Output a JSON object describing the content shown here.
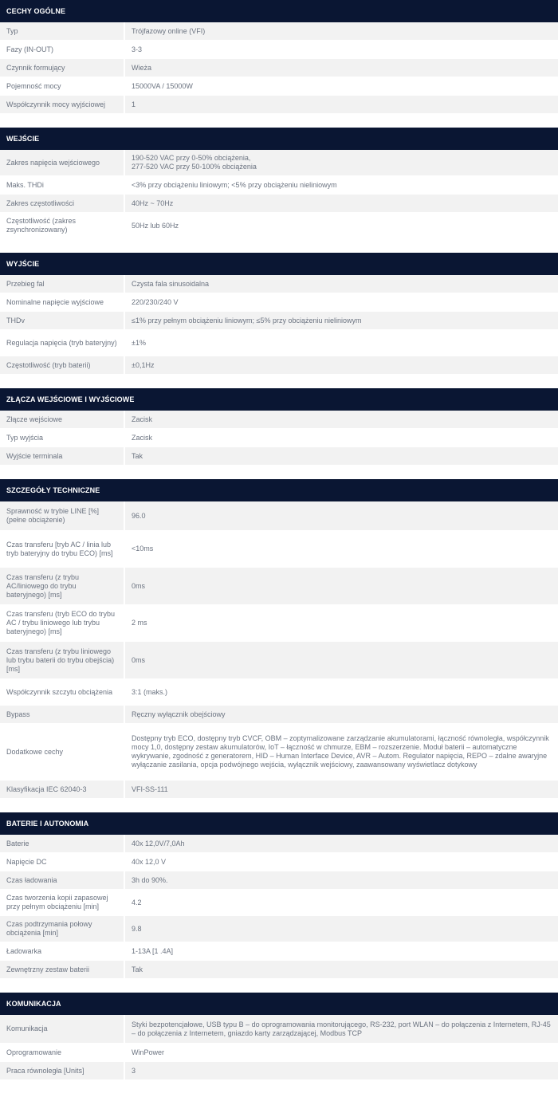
{
  "sections": [
    {
      "title": "CECHY OGÓLNE",
      "rows": [
        {
          "label": "Typ",
          "value": "Trójfazowy online (VFI)",
          "h": 23
        },
        {
          "label": "Fazy (IN-OUT)",
          "value": "3-3",
          "h": 23
        },
        {
          "label": "Czynnik formujący",
          "value": "Wieża",
          "h": 23
        },
        {
          "label": "Pojemność mocy",
          "value": "15000VA / 15000W",
          "h": 23
        },
        {
          "label": "Współczynnik mocy wyjściowej",
          "value": "1",
          "h": 23
        }
      ]
    },
    {
      "title": "WEJŚCIE",
      "rows": [
        {
          "label": "Zakres napięcia wejściowego",
          "value": "190-520 VAC przy 0-50% obciążenia,\n277-520 VAC przy 50-100% obciążenia",
          "h": 33
        },
        {
          "label": "Maks. THDi",
          "value": "<3% przy obciążeniu liniowym; <5% przy obciążeniu nieliniowym",
          "h": 23
        },
        {
          "label": "Zakres częstotliwości",
          "value": "40Hz ~ 70Hz",
          "h": 23
        },
        {
          "label": "Częstotliwość (zakres zsynchronizowany)",
          "value": "50Hz lub 60Hz",
          "h": 33
        }
      ]
    },
    {
      "title": "WYJŚCIE",
      "rows": [
        {
          "label": "Przebieg fal",
          "value": "Czysta fala sinusoidalna",
          "h": 23
        },
        {
          "label": "Nominalne napięcie wyjściowe",
          "value": "220/230/240 V",
          "h": 23
        },
        {
          "label": "THDv",
          "value": "≤1% przy pełnym obciążeniu liniowym; ≤5% przy obciążeniu nieliniowym",
          "h": 23
        },
        {
          "label": "Regulacja napięcia (tryb bateryjny)",
          "value": "±1%",
          "h": 33
        },
        {
          "label": "Częstotliwość (tryb baterii)",
          "value": "±0,1Hz",
          "h": 23
        }
      ]
    },
    {
      "title": "ZŁĄCZA WEJŚCIOWE I WYJŚCIOWE",
      "rows": [
        {
          "label": "Złącze wejściowe",
          "value": "Zacisk",
          "h": 23
        },
        {
          "label": "Typ wyjścia",
          "value": "Zacisk",
          "h": 23
        },
        {
          "label": "Wyjście terminala",
          "value": "Tak",
          "h": 23
        }
      ]
    },
    {
      "title": "SZCZEGÓŁY TECHNICZNE",
      "rows": [
        {
          "label": "Sprawność w trybie LINE [%] (pełne obciążenie)",
          "value": "96.0",
          "h": 37
        },
        {
          "label": "Czas transferu [tryb AC / linia lub tryb bateryjny do trybu ECO) [ms]",
          "value": "<10ms",
          "h": 46
        },
        {
          "label": "Czas transferu (z trybu AC/liniowego do trybu bateryjnego) [ms]",
          "value": "0ms",
          "h": 47
        },
        {
          "label": "Czas transferu (tryb ECO do trybu AC / trybu liniowego lub trybu bateryjnego) [ms]",
          "value": "2 ms",
          "h": 46
        },
        {
          "label": "Czas transferu (z trybu liniowego lub trybu baterii do trybu obejścia) [ms]",
          "value": "0ms",
          "h": 47
        },
        {
          "label": "Współczynnik szczytu obciążenia",
          "value": "3:1 (maks.)",
          "h": 33
        },
        {
          "label": "Bypass",
          "value": "Ręczny wyłącznik obejściowy",
          "h": 23
        },
        {
          "label": "Dodatkowe cechy",
          "value": "Dostępny tryb ECO, dostępny tryb CVCF, OBM – zoptymalizowane zarządzanie akumulatorami, łączność równoległa, współczynnik mocy 1,0, dostępny zestaw akumulatorów, IoT – łączność w chmurze, EBM – rozszerzenie. Moduł baterii – automatyczne wykrywanie, zgodność z generatorem, HID – Human Interface Device, AVR – Autom. Regulator napięcia, REPO – zdalne awaryjne wyłączanie zasilania, opcja podwójnego wejścia, wyłącznik wejściowy, zaawansowany wyświetlacz dotykowy",
          "h": 71
        },
        {
          "label": "Klasyfikacja IEC 62040-3",
          "value": "VFI-SS-111",
          "h": 23
        }
      ]
    },
    {
      "title": "BATERIE I AUTONOMIA",
      "rows": [
        {
          "label": "Baterie",
          "value": "40x 12,0V/7,0Ah",
          "h": 23
        },
        {
          "label": "Napięcie DC",
          "value": "40x 12,0 V",
          "h": 23
        },
        {
          "label": "Czas ładowania",
          "value": "3h do 90%.",
          "h": 23
        },
        {
          "label": "Czas tworzenia kopii zapasowej przy pełnym obciążeniu [min]",
          "value": "4.2",
          "h": 33
        },
        {
          "label": "Czas podtrzymania połowy obciążenia [min]",
          "value": "9.8",
          "h": 33
        },
        {
          "label": "Ładowarka",
          "value": "1-13A [1 .4A]",
          "h": 23
        },
        {
          "label": "Zewnętrzny zestaw baterii",
          "value": "Tak",
          "h": 23
        }
      ]
    },
    {
      "title": "KOMUNIKACJA",
      "rows": [
        {
          "label": "Komunikacja",
          "value": "Styki bezpotencjałowe, USB typu B – do oprogramowania monitorującego, RS-232, port WLAN – do połączenia z Internetem, RJ-45 – do połączenia z Internetem, gniazdo karty zarządzającej, Modbus TCP",
          "h": 36
        },
        {
          "label": "Oprogramowanie",
          "value": "WinPower",
          "h": 23
        },
        {
          "label": "Praca równoległa [Units]",
          "value": "3",
          "h": 23
        }
      ]
    }
  ]
}
